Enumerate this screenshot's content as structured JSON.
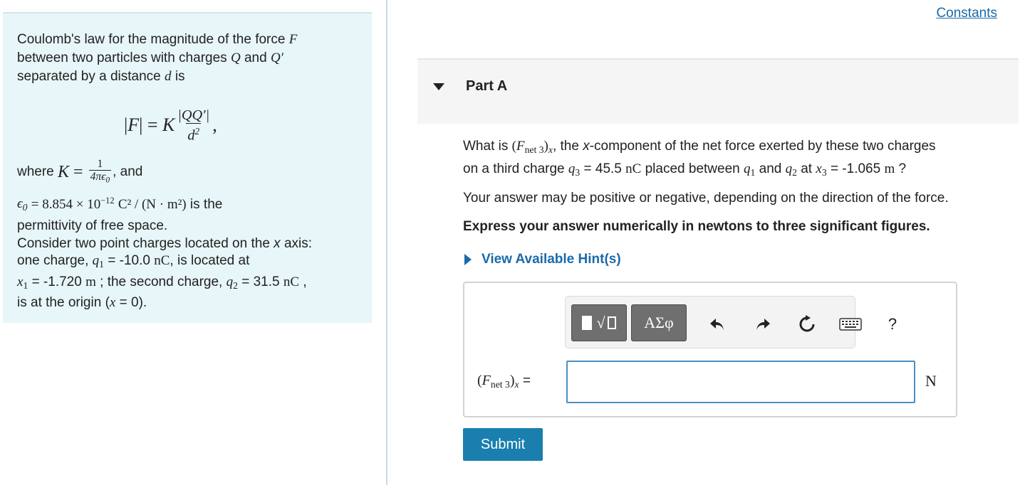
{
  "header": {
    "constants_link": "Constants"
  },
  "info": {
    "intro": "Coulomb's law for the magnitude of the force",
    "force_symbol": "F",
    "intro2": "between two particles with charges",
    "q": "Q",
    "and": "and",
    "q_prime": "Q′",
    "intro3": "separated by a distance",
    "d": "d",
    "is": "is",
    "where": "where",
    "and2": ", and",
    "eps_value": "= 8.854 × 10",
    "eps_exp": "−12",
    "eps_units": "C² / (N · m²)",
    "eps_tail": "is the",
    "eps_tail2": "permittivity of free space.",
    "scenario_1": "Consider two point charges located on the",
    "scenario_axis": "x",
    "scenario_2": "axis:",
    "scenario_3": "one charge,",
    "q1_value": "= -10.0",
    "q1_unit": "nC",
    "scenario_4": ", is located at",
    "x1_value": "= -1.720",
    "x1_unit": "m",
    "scenario_5": "; the second charge,",
    "q2_value": "= 31.5",
    "q2_unit": "nC",
    "scenario_6": ",",
    "scenario_7": "is at the origin (",
    "scenario_8": "= 0)."
  },
  "part": {
    "title": "Part A"
  },
  "question": {
    "prefix": "What is",
    "mid": ", the",
    "x_comp": "x",
    "text1": "-component of the net force exerted by these two charges",
    "text2": "on a third charge",
    "q3_value": "= 45.5",
    "q3_unit": "nC",
    "text3": "placed between",
    "and": "and",
    "at": "at",
    "x3_value": "= -1.065",
    "x3_unit": "m",
    "end": "?"
  },
  "note": "Your answer may be positive or negative, depending on the direction of the force.",
  "instruction": "Express your answer numerically in newtons to three significant figures.",
  "hint": {
    "label": "View Available Hint(s)"
  },
  "answer": {
    "label_eq": "=",
    "value": "",
    "unit": "N",
    "greek_label": "ΑΣφ",
    "help_label": "?"
  },
  "submit": {
    "label": "Submit"
  }
}
